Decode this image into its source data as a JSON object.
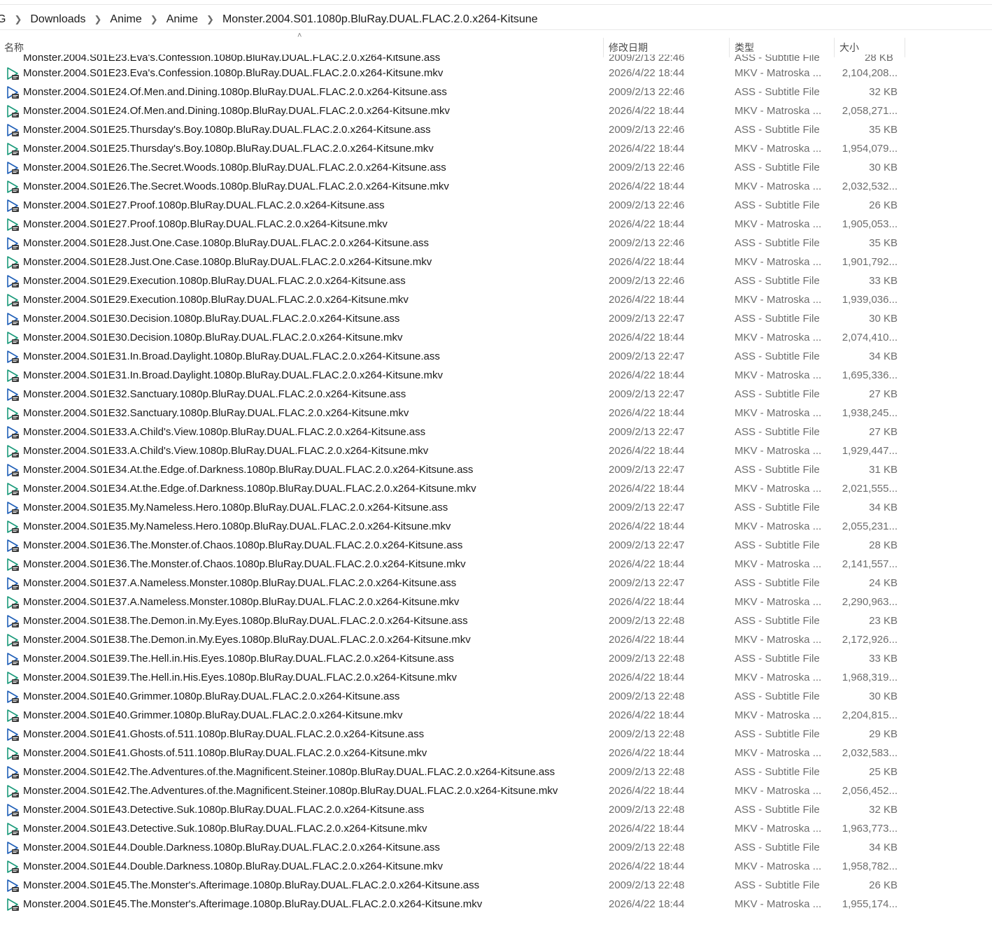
{
  "breadcrumb": [
    "G",
    "Downloads",
    "Anime",
    "Anime",
    "Monster.2004.S01.1080p.BluRay.DUAL.FLAC.2.0.x264-Kitsune"
  ],
  "columns": {
    "name": "名称",
    "date": "修改日期",
    "type": "类型",
    "size": "大小"
  },
  "partial_row": {
    "name": "Monster.2004.S01E23.Eva's.Confession.1080p.BluRay.DUAL.FLAC.2.0.x264-Kitsune.ass",
    "date": "2009/2/13 22:46",
    "type": "ASS - Subtitle File",
    "size": "28 KB"
  },
  "files": [
    {
      "name": "Monster.2004.S01E23.Eva's.Confession.1080p.BluRay.DUAL.FLAC.2.0.x264-Kitsune.mkv",
      "date": "2026/4/22 18:44",
      "type": "MKV - Matroska ...",
      "size": "2,104,208...",
      "icon": "video-file-icon"
    },
    {
      "name": "Monster.2004.S01E24.Of.Men.and.Dining.1080p.BluRay.DUAL.FLAC.2.0.x264-Kitsune.ass",
      "date": "2009/2/13 22:46",
      "type": "ASS - Subtitle File",
      "size": "32 KB",
      "icon": "subtitle-file-icon"
    },
    {
      "name": "Monster.2004.S01E24.Of.Men.and.Dining.1080p.BluRay.DUAL.FLAC.2.0.x264-Kitsune.mkv",
      "date": "2026/4/22 18:44",
      "type": "MKV - Matroska ...",
      "size": "2,058,271...",
      "icon": "video-file-icon"
    },
    {
      "name": "Monster.2004.S01E25.Thursday's.Boy.1080p.BluRay.DUAL.FLAC.2.0.x264-Kitsune.ass",
      "date": "2009/2/13 22:46",
      "type": "ASS - Subtitle File",
      "size": "35 KB",
      "icon": "subtitle-file-icon"
    },
    {
      "name": "Monster.2004.S01E25.Thursday's.Boy.1080p.BluRay.DUAL.FLAC.2.0.x264-Kitsune.mkv",
      "date": "2026/4/22 18:44",
      "type": "MKV - Matroska ...",
      "size": "1,954,079...",
      "icon": "video-file-icon"
    },
    {
      "name": "Monster.2004.S01E26.The.Secret.Woods.1080p.BluRay.DUAL.FLAC.2.0.x264-Kitsune.ass",
      "date": "2009/2/13 22:46",
      "type": "ASS - Subtitle File",
      "size": "30 KB",
      "icon": "subtitle-file-icon"
    },
    {
      "name": "Monster.2004.S01E26.The.Secret.Woods.1080p.BluRay.DUAL.FLAC.2.0.x264-Kitsune.mkv",
      "date": "2026/4/22 18:44",
      "type": "MKV - Matroska ...",
      "size": "2,032,532...",
      "icon": "video-file-icon"
    },
    {
      "name": "Monster.2004.S01E27.Proof.1080p.BluRay.DUAL.FLAC.2.0.x264-Kitsune.ass",
      "date": "2009/2/13 22:46",
      "type": "ASS - Subtitle File",
      "size": "26 KB",
      "icon": "subtitle-file-icon"
    },
    {
      "name": "Monster.2004.S01E27.Proof.1080p.BluRay.DUAL.FLAC.2.0.x264-Kitsune.mkv",
      "date": "2026/4/22 18:44",
      "type": "MKV - Matroska ...",
      "size": "1,905,053...",
      "icon": "video-file-icon"
    },
    {
      "name": "Monster.2004.S01E28.Just.One.Case.1080p.BluRay.DUAL.FLAC.2.0.x264-Kitsune.ass",
      "date": "2009/2/13 22:46",
      "type": "ASS - Subtitle File",
      "size": "35 KB",
      "icon": "subtitle-file-icon"
    },
    {
      "name": "Monster.2004.S01E28.Just.One.Case.1080p.BluRay.DUAL.FLAC.2.0.x264-Kitsune.mkv",
      "date": "2026/4/22 18:44",
      "type": "MKV - Matroska ...",
      "size": "1,901,792...",
      "icon": "video-file-icon"
    },
    {
      "name": "Monster.2004.S01E29.Execution.1080p.BluRay.DUAL.FLAC.2.0.x264-Kitsune.ass",
      "date": "2009/2/13 22:46",
      "type": "ASS - Subtitle File",
      "size": "33 KB",
      "icon": "subtitle-file-icon"
    },
    {
      "name": "Monster.2004.S01E29.Execution.1080p.BluRay.DUAL.FLAC.2.0.x264-Kitsune.mkv",
      "date": "2026/4/22 18:44",
      "type": "MKV - Matroska ...",
      "size": "1,939,036...",
      "icon": "video-file-icon"
    },
    {
      "name": "Monster.2004.S01E30.Decision.1080p.BluRay.DUAL.FLAC.2.0.x264-Kitsune.ass",
      "date": "2009/2/13 22:47",
      "type": "ASS - Subtitle File",
      "size": "30 KB",
      "icon": "subtitle-file-icon"
    },
    {
      "name": "Monster.2004.S01E30.Decision.1080p.BluRay.DUAL.FLAC.2.0.x264-Kitsune.mkv",
      "date": "2026/4/22 18:44",
      "type": "MKV - Matroska ...",
      "size": "2,074,410...",
      "icon": "video-file-icon"
    },
    {
      "name": "Monster.2004.S01E31.In.Broad.Daylight.1080p.BluRay.DUAL.FLAC.2.0.x264-Kitsune.ass",
      "date": "2009/2/13 22:47",
      "type": "ASS - Subtitle File",
      "size": "34 KB",
      "icon": "subtitle-file-icon"
    },
    {
      "name": "Monster.2004.S01E31.In.Broad.Daylight.1080p.BluRay.DUAL.FLAC.2.0.x264-Kitsune.mkv",
      "date": "2026/4/22 18:44",
      "type": "MKV - Matroska ...",
      "size": "1,695,336...",
      "icon": "video-file-icon"
    },
    {
      "name": "Monster.2004.S01E32.Sanctuary.1080p.BluRay.DUAL.FLAC.2.0.x264-Kitsune.ass",
      "date": "2009/2/13 22:47",
      "type": "ASS - Subtitle File",
      "size": "27 KB",
      "icon": "subtitle-file-icon"
    },
    {
      "name": "Monster.2004.S01E32.Sanctuary.1080p.BluRay.DUAL.FLAC.2.0.x264-Kitsune.mkv",
      "date": "2026/4/22 18:44",
      "type": "MKV - Matroska ...",
      "size": "1,938,245...",
      "icon": "video-file-icon"
    },
    {
      "name": "Monster.2004.S01E33.A.Child's.View.1080p.BluRay.DUAL.FLAC.2.0.x264-Kitsune.ass",
      "date": "2009/2/13 22:47",
      "type": "ASS - Subtitle File",
      "size": "27 KB",
      "icon": "subtitle-file-icon"
    },
    {
      "name": "Monster.2004.S01E33.A.Child's.View.1080p.BluRay.DUAL.FLAC.2.0.x264-Kitsune.mkv",
      "date": "2026/4/22 18:44",
      "type": "MKV - Matroska ...",
      "size": "1,929,447...",
      "icon": "video-file-icon"
    },
    {
      "name": "Monster.2004.S01E34.At.the.Edge.of.Darkness.1080p.BluRay.DUAL.FLAC.2.0.x264-Kitsune.ass",
      "date": "2009/2/13 22:47",
      "type": "ASS - Subtitle File",
      "size": "31 KB",
      "icon": "subtitle-file-icon"
    },
    {
      "name": "Monster.2004.S01E34.At.the.Edge.of.Darkness.1080p.BluRay.DUAL.FLAC.2.0.x264-Kitsune.mkv",
      "date": "2026/4/22 18:44",
      "type": "MKV - Matroska ...",
      "size": "2,021,555...",
      "icon": "video-file-icon"
    },
    {
      "name": "Monster.2004.S01E35.My.Nameless.Hero.1080p.BluRay.DUAL.FLAC.2.0.x264-Kitsune.ass",
      "date": "2009/2/13 22:47",
      "type": "ASS - Subtitle File",
      "size": "34 KB",
      "icon": "subtitle-file-icon"
    },
    {
      "name": "Monster.2004.S01E35.My.Nameless.Hero.1080p.BluRay.DUAL.FLAC.2.0.x264-Kitsune.mkv",
      "date": "2026/4/22 18:44",
      "type": "MKV - Matroska ...",
      "size": "2,055,231...",
      "icon": "video-file-icon"
    },
    {
      "name": "Monster.2004.S01E36.The.Monster.of.Chaos.1080p.BluRay.DUAL.FLAC.2.0.x264-Kitsune.ass",
      "date": "2009/2/13 22:47",
      "type": "ASS - Subtitle File",
      "size": "28 KB",
      "icon": "subtitle-file-icon"
    },
    {
      "name": "Monster.2004.S01E36.The.Monster.of.Chaos.1080p.BluRay.DUAL.FLAC.2.0.x264-Kitsune.mkv",
      "date": "2026/4/22 18:44",
      "type": "MKV - Matroska ...",
      "size": "2,141,557...",
      "icon": "video-file-icon"
    },
    {
      "name": "Monster.2004.S01E37.A.Nameless.Monster.1080p.BluRay.DUAL.FLAC.2.0.x264-Kitsune.ass",
      "date": "2009/2/13 22:47",
      "type": "ASS - Subtitle File",
      "size": "24 KB",
      "icon": "subtitle-file-icon"
    },
    {
      "name": "Monster.2004.S01E37.A.Nameless.Monster.1080p.BluRay.DUAL.FLAC.2.0.x264-Kitsune.mkv",
      "date": "2026/4/22 18:44",
      "type": "MKV - Matroska ...",
      "size": "2,290,963...",
      "icon": "video-file-icon"
    },
    {
      "name": "Monster.2004.S01E38.The.Demon.in.My.Eyes.1080p.BluRay.DUAL.FLAC.2.0.x264-Kitsune.ass",
      "date": "2009/2/13 22:48",
      "type": "ASS - Subtitle File",
      "size": "23 KB",
      "icon": "subtitle-file-icon"
    },
    {
      "name": "Monster.2004.S01E38.The.Demon.in.My.Eyes.1080p.BluRay.DUAL.FLAC.2.0.x264-Kitsune.mkv",
      "date": "2026/4/22 18:44",
      "type": "MKV - Matroska ...",
      "size": "2,172,926...",
      "icon": "video-file-icon"
    },
    {
      "name": "Monster.2004.S01E39.The.Hell.in.His.Eyes.1080p.BluRay.DUAL.FLAC.2.0.x264-Kitsune.ass",
      "date": "2009/2/13 22:48",
      "type": "ASS - Subtitle File",
      "size": "33 KB",
      "icon": "subtitle-file-icon"
    },
    {
      "name": "Monster.2004.S01E39.The.Hell.in.His.Eyes.1080p.BluRay.DUAL.FLAC.2.0.x264-Kitsune.mkv",
      "date": "2026/4/22 18:44",
      "type": "MKV - Matroska ...",
      "size": "1,968,319...",
      "icon": "video-file-icon"
    },
    {
      "name": "Monster.2004.S01E40.Grimmer.1080p.BluRay.DUAL.FLAC.2.0.x264-Kitsune.ass",
      "date": "2009/2/13 22:48",
      "type": "ASS - Subtitle File",
      "size": "30 KB",
      "icon": "subtitle-file-icon"
    },
    {
      "name": "Monster.2004.S01E40.Grimmer.1080p.BluRay.DUAL.FLAC.2.0.x264-Kitsune.mkv",
      "date": "2026/4/22 18:44",
      "type": "MKV - Matroska ...",
      "size": "2,204,815...",
      "icon": "video-file-icon"
    },
    {
      "name": "Monster.2004.S01E41.Ghosts.of.511.1080p.BluRay.DUAL.FLAC.2.0.x264-Kitsune.ass",
      "date": "2009/2/13 22:48",
      "type": "ASS - Subtitle File",
      "size": "29 KB",
      "icon": "subtitle-file-icon"
    },
    {
      "name": "Monster.2004.S01E41.Ghosts.of.511.1080p.BluRay.DUAL.FLAC.2.0.x264-Kitsune.mkv",
      "date": "2026/4/22 18:44",
      "type": "MKV - Matroska ...",
      "size": "2,032,583...",
      "icon": "video-file-icon"
    },
    {
      "name": "Monster.2004.S01E42.The.Adventures.of.the.Magnificent.Steiner.1080p.BluRay.DUAL.FLAC.2.0.x264-Kitsune.ass",
      "date": "2009/2/13 22:48",
      "type": "ASS - Subtitle File",
      "size": "25 KB",
      "icon": "subtitle-file-icon"
    },
    {
      "name": "Monster.2004.S01E42.The.Adventures.of.the.Magnificent.Steiner.1080p.BluRay.DUAL.FLAC.2.0.x264-Kitsune.mkv",
      "date": "2026/4/22 18:44",
      "type": "MKV - Matroska ...",
      "size": "2,056,452...",
      "icon": "video-file-icon"
    },
    {
      "name": "Monster.2004.S01E43.Detective.Suk.1080p.BluRay.DUAL.FLAC.2.0.x264-Kitsune.ass",
      "date": "2009/2/13 22:48",
      "type": "ASS - Subtitle File",
      "size": "32 KB",
      "icon": "subtitle-file-icon"
    },
    {
      "name": "Monster.2004.S01E43.Detective.Suk.1080p.BluRay.DUAL.FLAC.2.0.x264-Kitsune.mkv",
      "date": "2026/4/22 18:44",
      "type": "MKV - Matroska ...",
      "size": "1,963,773...",
      "icon": "video-file-icon"
    },
    {
      "name": "Monster.2004.S01E44.Double.Darkness.1080p.BluRay.DUAL.FLAC.2.0.x264-Kitsune.ass",
      "date": "2009/2/13 22:48",
      "type": "ASS - Subtitle File",
      "size": "34 KB",
      "icon": "subtitle-file-icon"
    },
    {
      "name": "Monster.2004.S01E44.Double.Darkness.1080p.BluRay.DUAL.FLAC.2.0.x264-Kitsune.mkv",
      "date": "2026/4/22 18:44",
      "type": "MKV - Matroska ...",
      "size": "1,958,782...",
      "icon": "video-file-icon"
    },
    {
      "name": "Monster.2004.S01E45.The.Monster's.Afterimage.1080p.BluRay.DUAL.FLAC.2.0.x264-Kitsune.ass",
      "date": "2009/2/13 22:48",
      "type": "ASS - Subtitle File",
      "size": "26 KB",
      "icon": "subtitle-file-icon"
    },
    {
      "name": "Monster.2004.S01E45.The.Monster's.Afterimage.1080p.BluRay.DUAL.FLAC.2.0.x264-Kitsune.mkv",
      "date": "2026/4/22 18:44",
      "type": "MKV - Matroska ...",
      "size": "1,955,174...",
      "icon": "video-file-icon"
    }
  ]
}
